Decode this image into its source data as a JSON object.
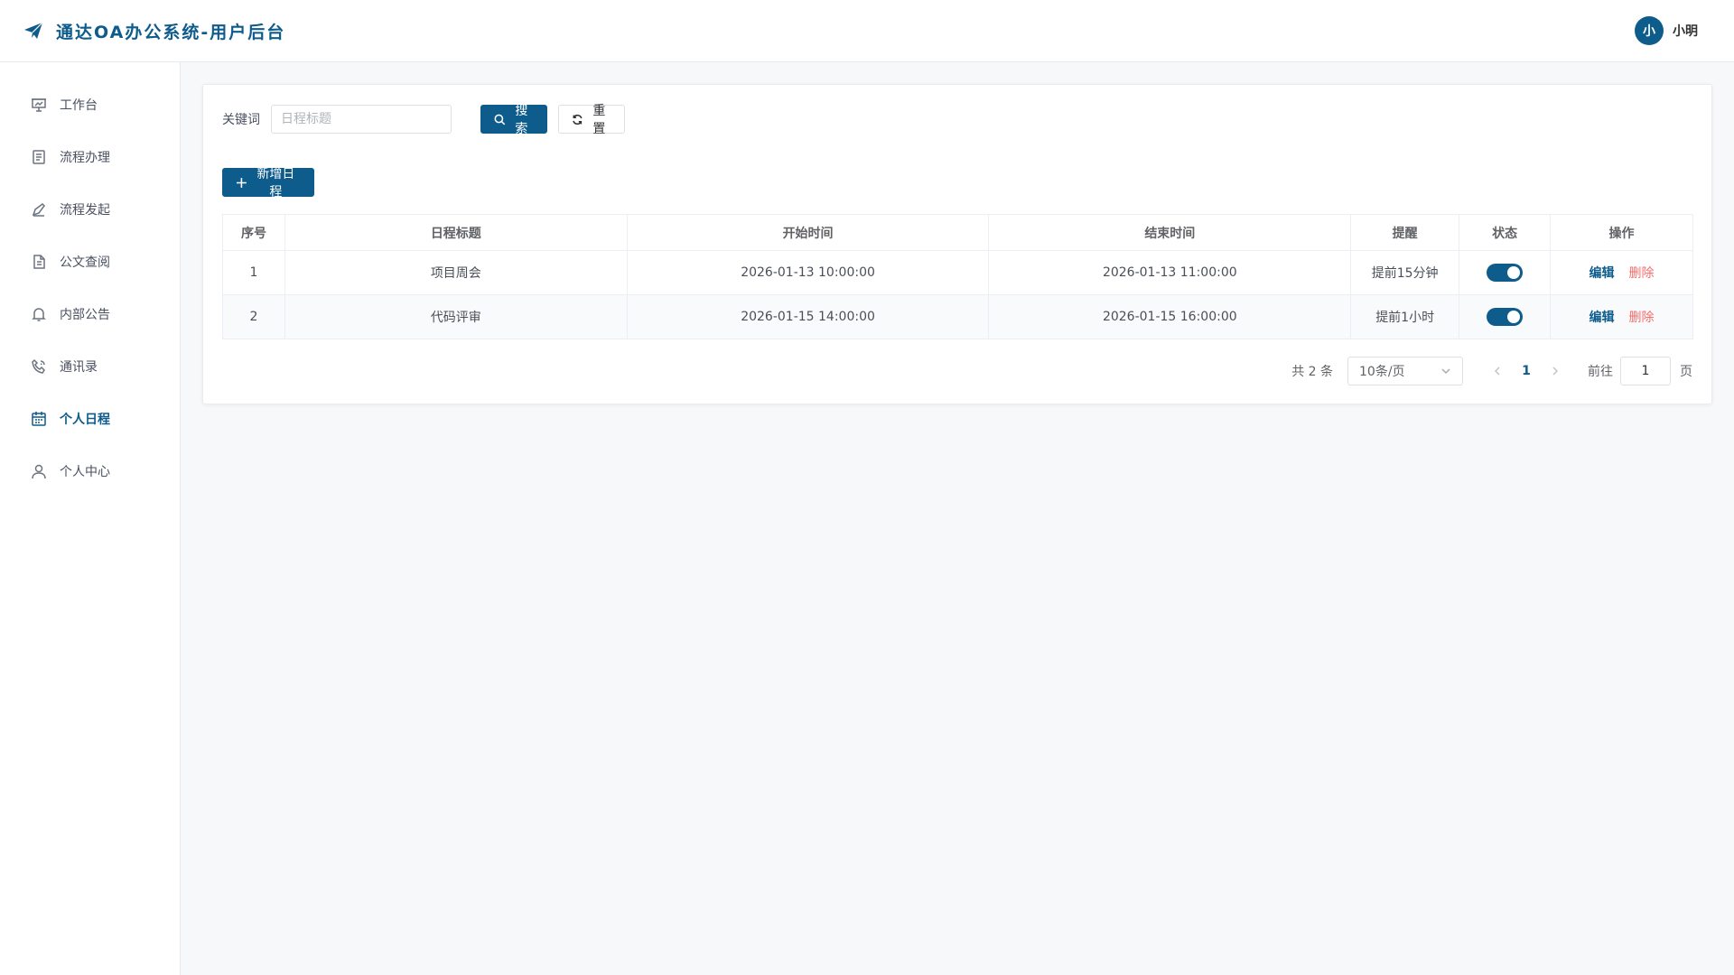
{
  "header": {
    "title": "通达OA办公系统-用户后台",
    "avatar_text": "小",
    "user_name": "小明"
  },
  "sidebar": {
    "items": [
      {
        "label": "工作台",
        "icon": "presentation-icon",
        "active": false
      },
      {
        "label": "流程办理",
        "icon": "document-icon",
        "active": false
      },
      {
        "label": "流程发起",
        "icon": "pen-icon",
        "active": false
      },
      {
        "label": "公文查阅",
        "icon": "file-icon",
        "active": false
      },
      {
        "label": "内部公告",
        "icon": "bell-icon",
        "active": false
      },
      {
        "label": "通讯录",
        "icon": "phone-icon",
        "active": false
      },
      {
        "label": "个人日程",
        "icon": "calendar-icon",
        "active": true
      },
      {
        "label": "个人中心",
        "icon": "user-icon",
        "active": false
      }
    ]
  },
  "search": {
    "label": "关键词",
    "placeholder": "日程标题",
    "value": "",
    "search_label": "搜索",
    "reset_label": "重置"
  },
  "actions": {
    "add_label": "新增日程"
  },
  "table": {
    "columns": [
      "序号",
      "日程标题",
      "开始时间",
      "结束时间",
      "提醒",
      "状态",
      "操作"
    ],
    "rows": [
      {
        "index": "1",
        "title": "项目周会",
        "start": "2026-01-13 10:00:00",
        "end": "2026-01-13 11:00:00",
        "remind": "提前15分钟",
        "enabled": true,
        "edit": "编辑",
        "delete": "删除"
      },
      {
        "index": "2",
        "title": "代码评审",
        "start": "2026-01-15 14:00:00",
        "end": "2026-01-15 16:00:00",
        "remind": "提前1小时",
        "enabled": true,
        "edit": "编辑",
        "delete": "删除"
      }
    ]
  },
  "pagination": {
    "total_text": "共 2 条",
    "page_size": "10条/页",
    "current_page": "1",
    "goto_label": "前往",
    "goto_value": "1",
    "page_unit": "页"
  },
  "colors": {
    "primary": "#0e5c8c",
    "danger": "#f56c6c"
  }
}
